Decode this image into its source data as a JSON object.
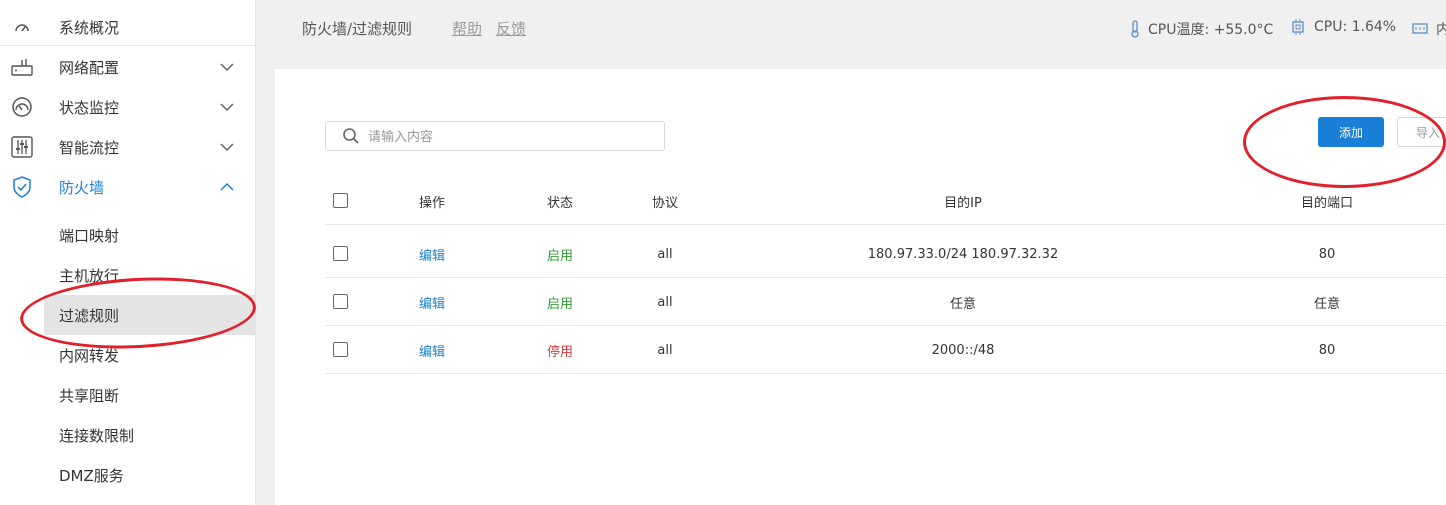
{
  "sidebar": {
    "items": [
      {
        "label": "系统概况",
        "icon": "dashboard-icon"
      },
      {
        "label": "网络配置",
        "icon": "router-icon"
      },
      {
        "label": "状态监控",
        "icon": "gauge-icon"
      },
      {
        "label": "智能流控",
        "icon": "sliders-icon"
      },
      {
        "label": "防火墙",
        "icon": "shield-icon"
      }
    ],
    "sub_items": [
      "端口映射",
      "主机放行",
      "过滤规则",
      "内网转发",
      "共享阻断",
      "连接数限制",
      "DMZ服务"
    ]
  },
  "header": {
    "breadcrumb": "防火墙/过滤规则",
    "help": "帮助",
    "feedback": "反馈",
    "cpu_temp": "CPU温度: +55.0°C",
    "cpu_usage": "CPU: 1.64%",
    "mem": "内"
  },
  "toolbar": {
    "search_placeholder": "请输入内容",
    "add": "添加",
    "import": "导入"
  },
  "table": {
    "columns": [
      "操作",
      "状态",
      "协议",
      "目的IP",
      "目的端口"
    ],
    "rows": [
      {
        "op": "编辑",
        "status": "启用",
        "protocol": "all",
        "ip": "180.97.33.0/24 180.97.32.32",
        "port": "80"
      },
      {
        "op": "编辑",
        "status": "启用",
        "protocol": "all",
        "ip": "任意",
        "port": "任意"
      },
      {
        "op": "编辑",
        "status": "停用",
        "protocol": "all",
        "ip": "2000::/48",
        "port": "80"
      }
    ]
  },
  "colors": {
    "accent": "#1a7fd6",
    "enabled": "#2e9e2e",
    "disabled": "#d9383a",
    "annotation": "#e0202a"
  }
}
